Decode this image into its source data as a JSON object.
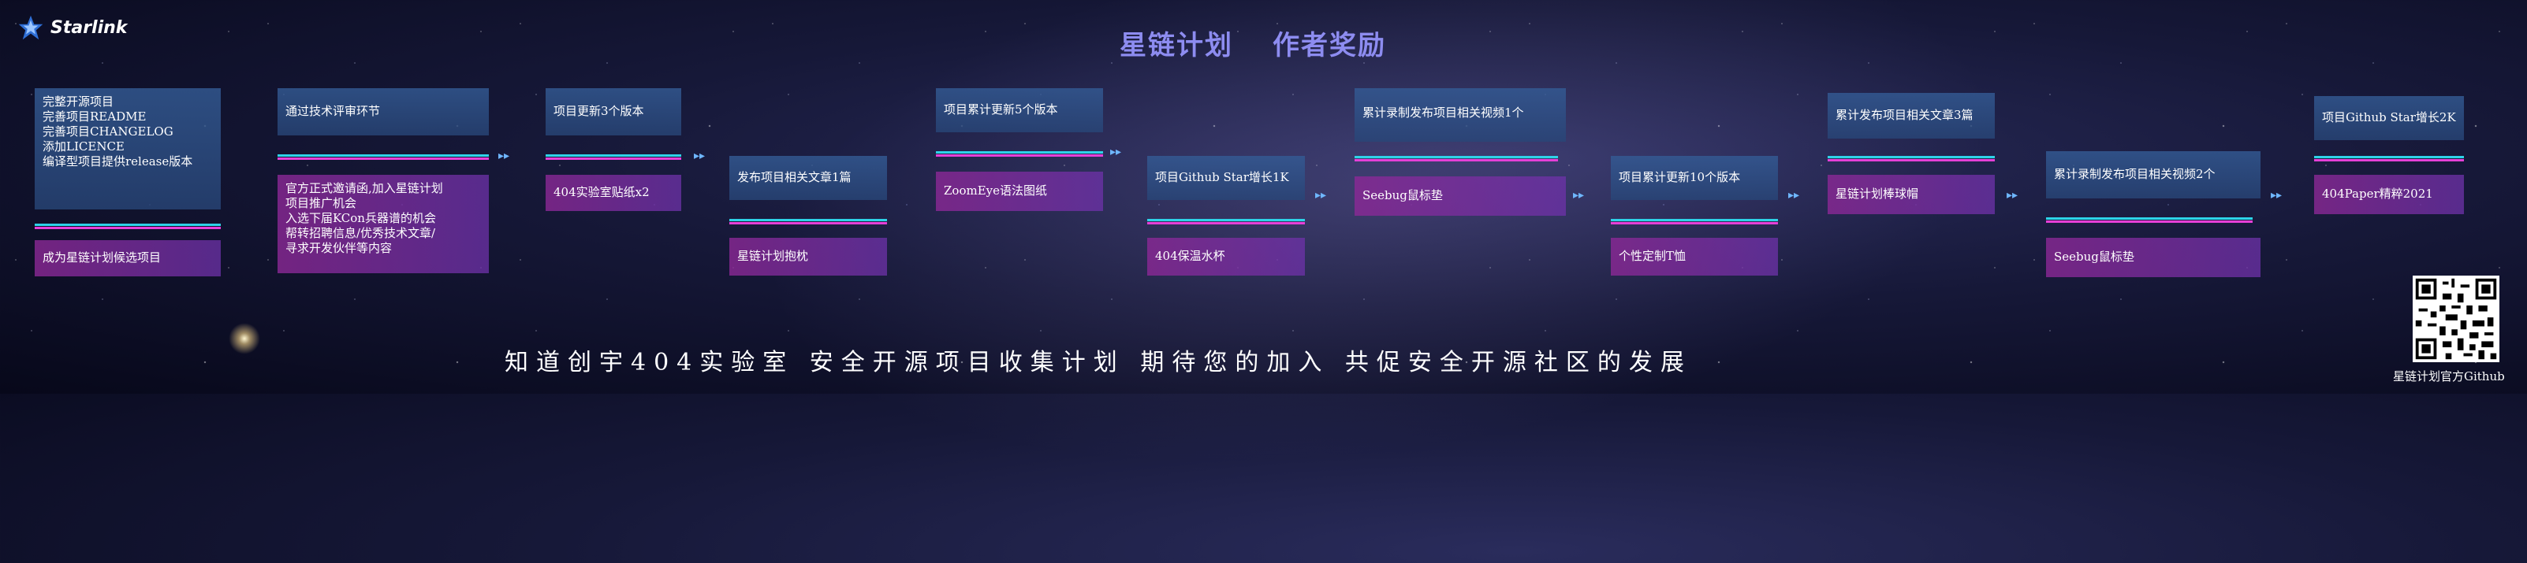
{
  "brand": {
    "name": "Starlink"
  },
  "title": {
    "left": "星链计划",
    "right": "作者奖励"
  },
  "stages": [
    {
      "id": "s1",
      "top": {
        "lines": [
          "完整开源项目",
          "完善项目README",
          "完善项目CHANGELOG",
          "添加LICENCE",
          "编译型项目提供release版本"
        ]
      },
      "bottom": {
        "lines": [
          "成为星链计划候选项目"
        ]
      }
    },
    {
      "id": "s2",
      "top": {
        "lines": [
          "通过技术评审环节"
        ]
      },
      "bottom": {
        "lines": [
          "官方正式邀请函,加入星链计划",
          "项目推广机会",
          "入选下届KCon兵器谱的机会",
          "帮转招聘信息/优秀技术文章/",
          "寻求开发伙伴等内容"
        ]
      }
    },
    {
      "id": "s3",
      "top": {
        "lines": [
          "项目更新3个版本"
        ]
      },
      "bottom": {
        "lines": [
          "404实验室贴纸x2"
        ]
      }
    },
    {
      "id": "s4",
      "top": {
        "lines": [
          "发布项目相关文章1篇"
        ]
      },
      "bottom": {
        "lines": [
          "星链计划抱枕"
        ]
      }
    },
    {
      "id": "s5",
      "top": {
        "lines": [
          "项目累计更新5个版本"
        ]
      },
      "bottom": {
        "lines": [
          "ZoomEye语法图纸"
        ]
      }
    },
    {
      "id": "s6",
      "top": {
        "lines": [
          "项目Github Star增长1K"
        ]
      },
      "bottom": {
        "lines": [
          "404保温水杯"
        ]
      }
    },
    {
      "id": "s7",
      "top": {
        "lines": [
          "累计录制发布项目相关视频1个"
        ]
      },
      "bottom": {
        "lines": [
          "Seebug鼠标垫"
        ]
      }
    },
    {
      "id": "s8",
      "top": {
        "lines": [
          "项目累计更新10个版本"
        ]
      },
      "bottom": {
        "lines": [
          "个性定制T恤"
        ]
      }
    },
    {
      "id": "s9",
      "top": {
        "lines": [
          "累计发布项目相关文章3篇"
        ]
      },
      "bottom": {
        "lines": [
          "星链计划棒球帽"
        ]
      }
    },
    {
      "id": "s10",
      "top": {
        "lines": [
          "累计录制发布项目相关视频2个"
        ]
      },
      "bottom": {
        "lines": [
          "Seebug鼠标垫"
        ]
      }
    },
    {
      "id": "s11",
      "top": {
        "lines": [
          "项目Github Star增长2K"
        ]
      },
      "bottom": {
        "lines": [
          "404Paper精粹2021"
        ]
      }
    }
  ],
  "footer": {
    "slogan": "知道创宇404实验室 安全开源项目收集计划 期待您的加入 共促安全开源社区的发展"
  },
  "qr": {
    "caption": "星链计划官方Github"
  },
  "colors": {
    "accent": "#8d8cf0",
    "cyan": "#2ed3e8",
    "magenta": "#e640d8"
  }
}
